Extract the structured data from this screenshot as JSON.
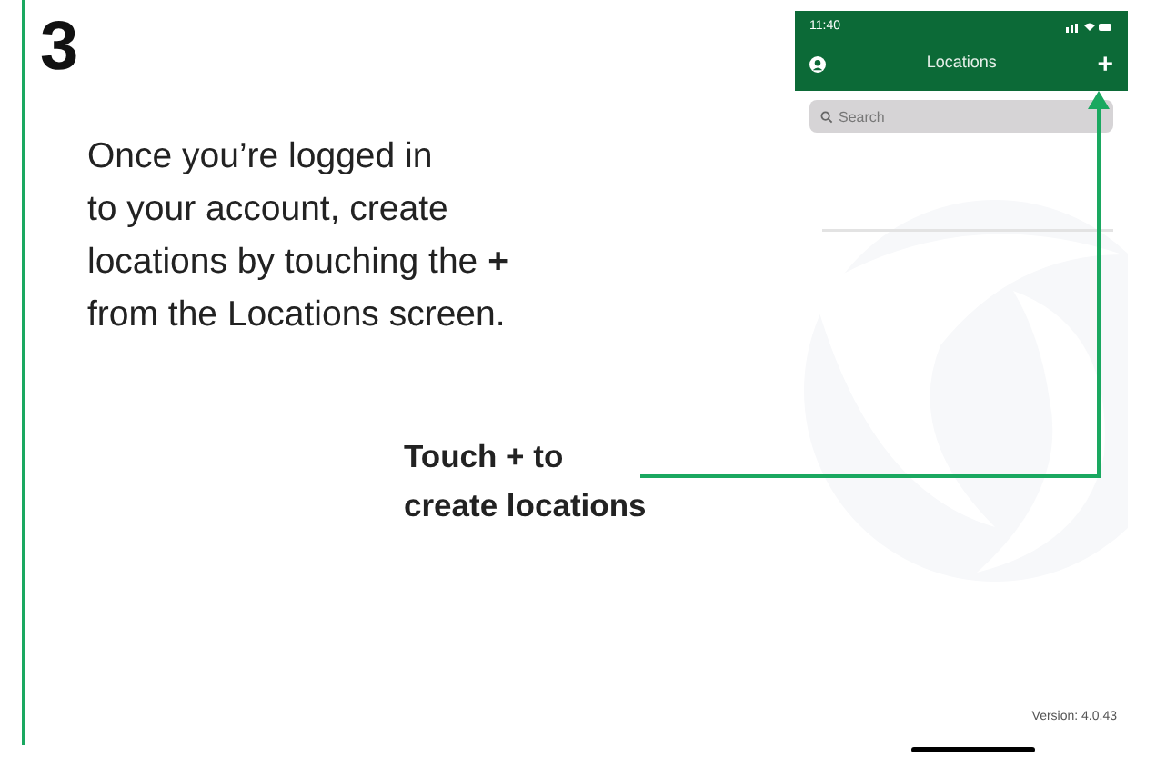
{
  "step": {
    "number": "3",
    "paragraph_lines": [
      "Once you’re logged in",
      "to your account, create",
      "locations by touching the **+**",
      "from the Locations screen."
    ]
  },
  "callout": {
    "lines": [
      "Touch + to",
      "create locations"
    ]
  },
  "phone": {
    "status_bar": {
      "time": "11:40"
    },
    "nav_bar": {
      "title": "Locations",
      "add": "+"
    },
    "search": {
      "placeholder": "Search"
    },
    "version": "Version: 4.0.43"
  }
}
